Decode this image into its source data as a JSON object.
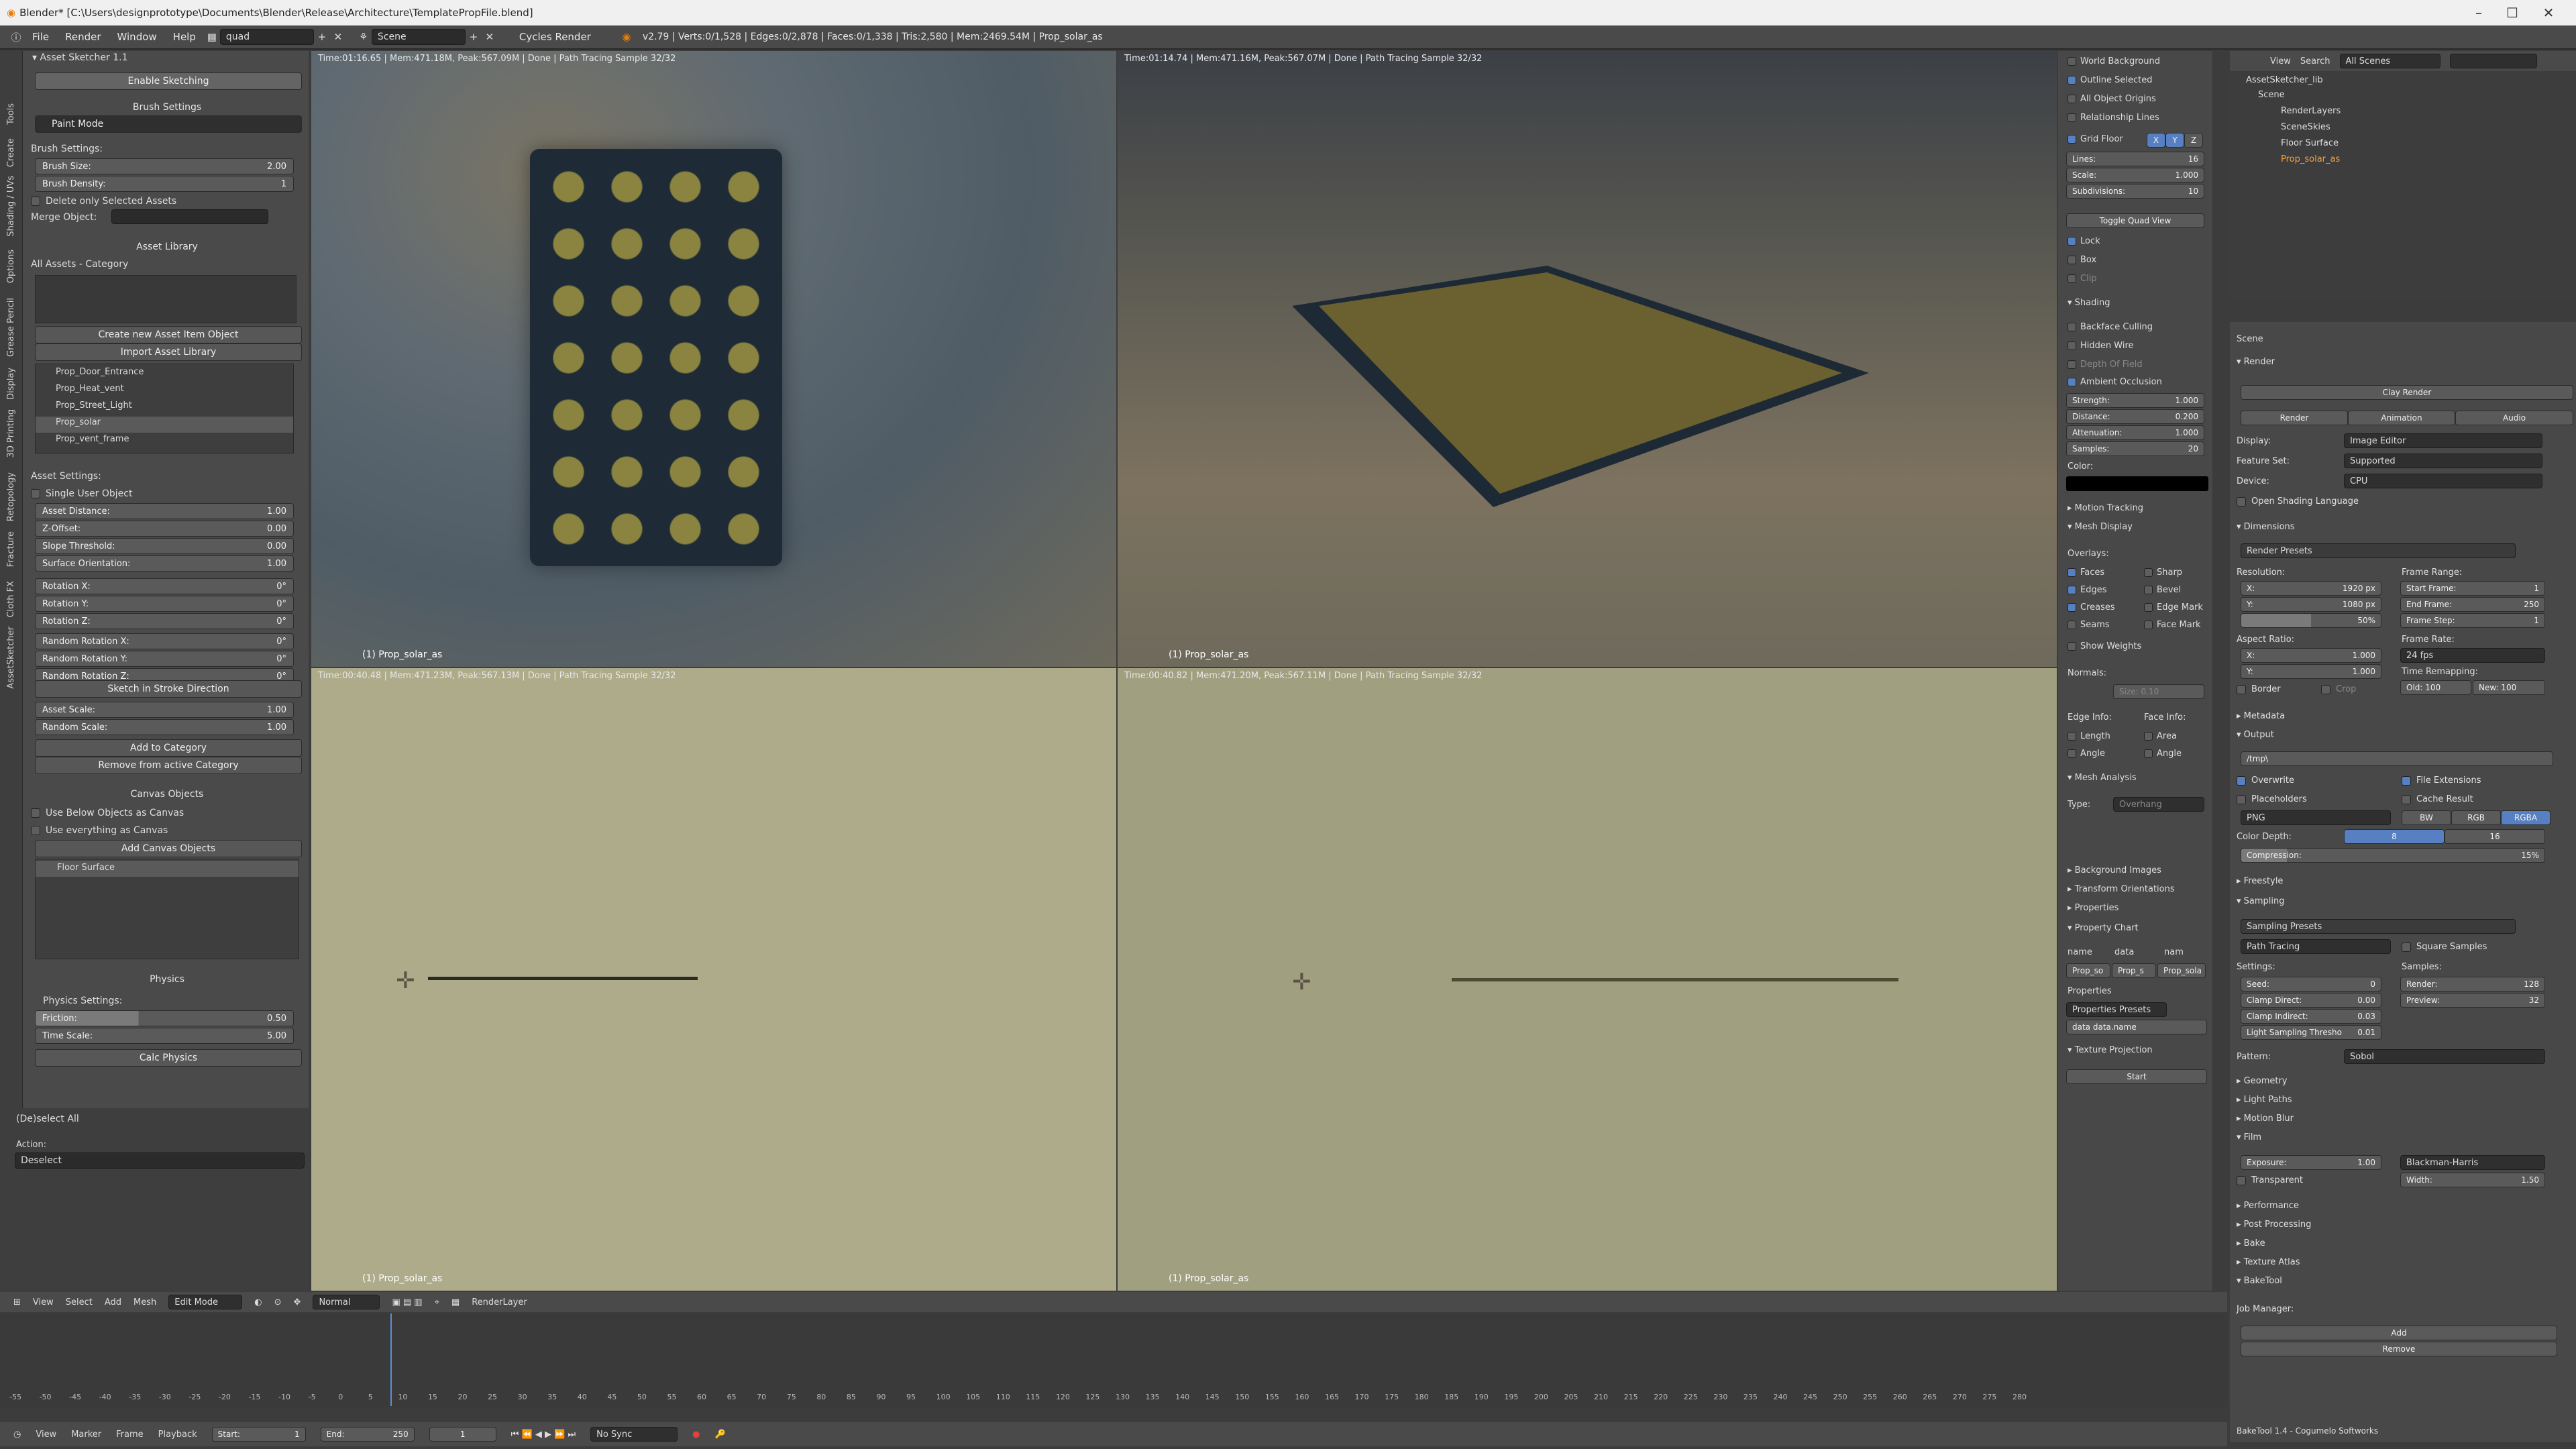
{
  "titlebar": {
    "title": "Blender* [C:\\Users\\designprototype\\Documents\\Blender\\Release\\Architecture\\TemplatePropFile.blend]",
    "min": "–",
    "max": "☐",
    "close": "✕"
  },
  "menubar": {
    "menus": [
      "File",
      "Render",
      "Window",
      "Help"
    ],
    "screen": "quad",
    "scene": "Scene",
    "engine": "Cycles Render",
    "stats": "v2.79 | Verts:0/1,528 | Edges:0/2,878 | Faces:0/1,338 | Tris:2,580 | Mem:2469.54M | Prop_solar_as"
  },
  "left_tabs": [
    "Tools",
    "Create",
    "Shading / UVs",
    "Options",
    "Grease Pencil",
    "Display",
    "3D Printing",
    "Retopology",
    "Fracture",
    "Cloth FX",
    "AssetSketcher"
  ],
  "asset_sketcher": {
    "title": "Asset Sketcher 1.1",
    "enable": "Enable Sketching",
    "brush_settings": "Brush Settings",
    "paint_mode": "Paint Mode",
    "brush_settings_label": "Brush Settings:",
    "brush_size_label": "Brush Size:",
    "brush_size": "2.00",
    "brush_density_label": "Brush Density:",
    "brush_density": "1",
    "delete_selected": "Delete only Selected Assets",
    "merge_object": "Merge Object:",
    "asset_library": "Asset Library",
    "all_assets": "All Assets - Category",
    "create_new": "Create new Asset Item Object",
    "import_library": "Import Asset Library",
    "assets": [
      "Prop_Door_Entrance",
      "Prop_Heat_vent",
      "Prop_Street_Light",
      "Prop_solar",
      "Prop_vent_frame"
    ],
    "asset_settings": "Asset Settings:",
    "single_user": "Single User Object",
    "fields": [
      {
        "label": "Asset Distance:",
        "value": "1.00"
      },
      {
        "label": "Z-Offset:",
        "value": "0.00"
      },
      {
        "label": "Slope Threshold:",
        "value": "0.00"
      },
      {
        "label": "Surface Orientation:",
        "value": "1.00"
      }
    ],
    "rotation": [
      {
        "label": "Rotation X:",
        "value": "0°"
      },
      {
        "label": "Rotation Y:",
        "value": "0°"
      },
      {
        "label": "Rotation Z:",
        "value": "0°"
      }
    ],
    "random_rotation": [
      {
        "label": "Random Rotation X:",
        "value": "0°"
      },
      {
        "label": "Random Rotation Y:",
        "value": "0°"
      },
      {
        "label": "Random Rotation Z:",
        "value": "0°"
      }
    ],
    "stroke_dir": "Sketch in Stroke Direction",
    "asset_scale_label": "Asset Scale:",
    "asset_scale": "1.00",
    "random_scale_label": "Random Scale:",
    "random_scale": "1.00",
    "add_category": "Add to Category",
    "remove_category": "Remove from active Category",
    "canvas_objects": "Canvas Objects",
    "use_below": "Use Below Objects as Canvas",
    "use_everything": "Use everything as Canvas",
    "add_canvas": "Add Canvas Objects",
    "floor_surface": "Floor Surface",
    "physics": "Physics",
    "physics_settings": "Physics Settings:",
    "friction_label": "Friction:",
    "friction": "0.50",
    "time_scale_label": "Time Scale:",
    "time_scale": "5.00",
    "calc_physics": "Calc Physics",
    "deselect_all": "(De)select All",
    "action_label": "Action:",
    "action": "Deselect"
  },
  "viewports": [
    {
      "info": "Time:01:16.65 | Mem:471.18M, Peak:567.09M | Done | Path Tracing Sample 32/32",
      "obj": "(1) Prop_solar_as"
    },
    {
      "info": "Time:01:14.74 | Mem:471.16M, Peak:567.07M | Done | Path Tracing Sample 32/32",
      "obj": "(1) Prop_solar_as"
    },
    {
      "info": "Time:00:40.48 | Mem:471.23M, Peak:567.13M | Done | Path Tracing Sample 32/32",
      "obj": "(1) Prop_solar_as"
    },
    {
      "info": "Time:00:40.82 | Mem:471.20M, Peak:567.11M | Done | Path Tracing Sample 32/32",
      "obj": "(1) Prop_solar_as"
    }
  ],
  "props": {
    "world_bg": "World Background",
    "outline": "Outline Selected",
    "all_origins": "All Object Origins",
    "rel_lines": "Relationship Lines",
    "grid_floor": "Grid Floor",
    "x": "X",
    "y": "Y",
    "z": "Z",
    "lines_l": "Lines:",
    "lines": "16",
    "scale_l": "Scale:",
    "scale": "1.000",
    "subdiv_l": "Subdivisions:",
    "subdiv": "10",
    "toggle_quad": "Toggle Quad View",
    "lock": "Lock",
    "box": "Box",
    "clip": "Clip",
    "shading": "Shading",
    "backface": "Backface Culling",
    "hidden_wire": "Hidden Wire",
    "dof": "Depth Of Field",
    "ao": "Ambient Occlusion",
    "strength_l": "Strength:",
    "strength": "1.000",
    "distance_l": "Distance:",
    "distance": "0.200",
    "atten_l": "Attenuation:",
    "atten": "1.000",
    "samples_l": "Samples:",
    "samples": "20",
    "color_l": "Color:",
    "motion": "Motion Tracking",
    "mesh_display": "Mesh Display",
    "overlays": "Overlays:",
    "faces": "Faces",
    "sharp": "Sharp",
    "edges": "Edges",
    "bevel": "Bevel",
    "creases": "Creases",
    "edge_mark": "Edge Mark",
    "seams": "Seams",
    "face_mark": "Face Mark",
    "show_weights": "Show Weights",
    "normals": "Normals:",
    "size": "Size: 0.10",
    "edge_info": "Edge Info:",
    "face_info": "Face Info:",
    "length": "Length",
    "area": "Area",
    "angle": "Angle",
    "angle2": "Angle",
    "mesh_analysis": "Mesh Analysis",
    "type_l": "Type:",
    "overhang": "Overhang",
    "bg_images": "Background Images",
    "transform_or": "Transform Orientations",
    "properties": "Properties",
    "prop_chart": "Property Chart",
    "pc_cols": [
      "name",
      "data",
      "nam"
    ],
    "pc_vals": [
      "Prop_so",
      "Prop_s",
      "Prop_sola"
    ],
    "properties2": "Properties",
    "prop_presets": "Properties Presets",
    "data_name": "data data.name",
    "texture_proj": "Texture Projection",
    "start": "Start"
  },
  "outliner": {
    "menus": [
      "View",
      "Search"
    ],
    "scenes": "All Scenes",
    "items": [
      "AssetSketcher_lib",
      "Scene",
      "RenderLayers",
      "SceneSkies",
      "Floor Surface",
      "Prop_solar_as"
    ]
  },
  "render": {
    "scene": "Scene",
    "render": "Render",
    "clay": "Clay Render",
    "tabs": [
      "Render",
      "Animation",
      "Audio"
    ],
    "display_l": "Display:",
    "display": "Image Editor",
    "feature_l": "Feature Set:",
    "feature": "Supported",
    "device_l": "Device:",
    "device": "CPU",
    "osl": "Open Shading Language",
    "dimensions": "Dimensions",
    "presets": "Render Presets",
    "resolution": "Resolution:",
    "res_x": "1920 px",
    "res_y": "1080 px",
    "res_pct": "50%",
    "frame_range": "Frame Range:",
    "start_frame_l": "Start Frame:",
    "start_frame": "1",
    "end_frame_l": "End Frame:",
    "end_frame": "250",
    "frame_step_l": "Frame Step:",
    "frame_step": "1",
    "aspect": "Aspect Ratio:",
    "asp_x": "1.000",
    "asp_y": "1.000",
    "frame_rate": "Frame Rate:",
    "fps": "24 fps",
    "remap": "Time Remapping:",
    "old": "Old: 100",
    "new": "New: 100",
    "border": "Border",
    "crop": "Crop",
    "metadata": "Metadata",
    "output": "Output",
    "path": "/tmp\\",
    "overwrite": "Overwrite",
    "file_ext": "File Extensions",
    "placeholders": "Placeholders",
    "cache": "Cache Result",
    "png": "PNG",
    "bw": "BW",
    "rgb": "RGB",
    "rgba": "RGBA",
    "color_depth": "Color Depth:",
    "d8": "8",
    "d16": "16",
    "compression": "Compression:",
    "compression_v": "15%",
    "freestyle": "Freestyle",
    "sampling": "Sampling",
    "sampling_presets": "Sampling Presets",
    "path_tracing": "Path Tracing",
    "square": "Square Samples",
    "settings": "Settings:",
    "seed_l": "Seed:",
    "seed": "0",
    "clamp_d_l": "Clamp Direct:",
    "clamp_d": "0.00",
    "clamp_i_l": "Clamp Indirect:",
    "clamp_i": "0.03",
    "light_l": "Light Sampling Thresho",
    "light": "0.01",
    "samples_h": "Samples:",
    "render_l": "Render:",
    "render_v": "128",
    "preview_l": "Preview:",
    "preview_v": "32",
    "pattern_l": "Pattern:",
    "pattern": "Sobol",
    "geometry": "Geometry",
    "light_paths": "Light Paths",
    "motion_blur": "Motion Blur",
    "film": "Film",
    "exposure_l": "Exposure:",
    "exposure": "1.00",
    "filter": "Blackman-Harris",
    "transparent": "Transparent",
    "width_l": "Width:",
    "width": "1.50",
    "performance": "Performance",
    "post": "Post Processing",
    "bake": "Bake",
    "texture_atlas": "Texture Atlas",
    "baketool": "BakeTool",
    "job_manager": "Job Manager:",
    "add": "Add",
    "remove": "Remove",
    "footer": "BakeTool 1.4 - Cogumelo Softworks"
  },
  "view3d_header": {
    "menus": [
      "View",
      "Select",
      "Add",
      "Mesh"
    ],
    "mode": "Edit Mode",
    "orientation": "Normal",
    "layer": "RenderLayer"
  },
  "timeline": {
    "ticks": [
      "-55",
      "-50",
      "-45",
      "-40",
      "-35",
      "-30",
      "-25",
      "-20",
      "-15",
      "-10",
      "-5",
      "0",
      "5",
      "10",
      "15",
      "20",
      "25",
      "30",
      "35",
      "40",
      "45",
      "50",
      "55",
      "60",
      "65",
      "70",
      "75",
      "80",
      "85",
      "90",
      "95",
      "100",
      "105",
      "110",
      "115",
      "120",
      "125",
      "130",
      "135",
      "140",
      "145",
      "150",
      "155",
      "160",
      "165",
      "170",
      "175",
      "180",
      "185",
      "190",
      "195",
      "200",
      "205",
      "210",
      "215",
      "220",
      "225",
      "230",
      "235",
      "240",
      "245",
      "250",
      "255",
      "260",
      "265",
      "270",
      "275",
      "280"
    ],
    "menus": [
      "View",
      "Marker",
      "Frame",
      "Playback"
    ],
    "start": "Start:",
    "start_v": "1",
    "end": "End:",
    "end_v": "250",
    "current": "1",
    "sync": "No Sync"
  }
}
